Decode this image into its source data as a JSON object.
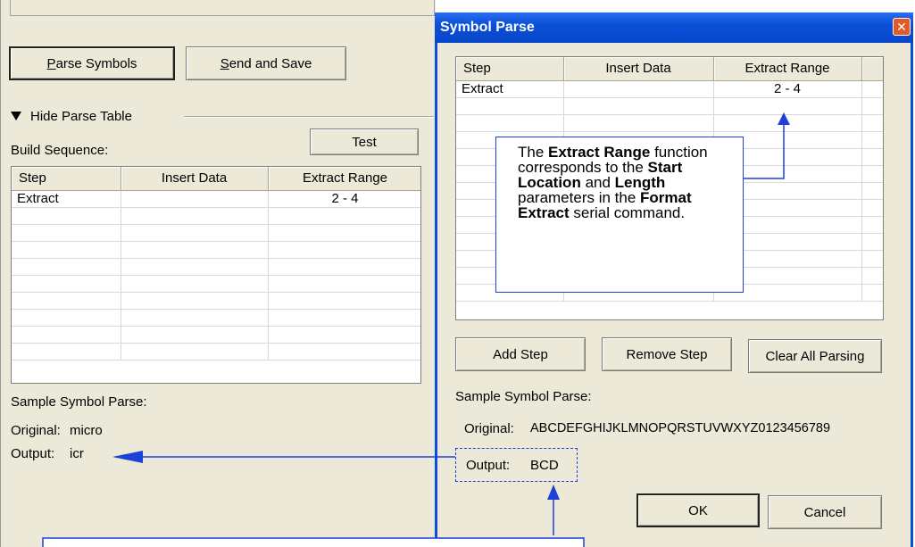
{
  "left_panel": {
    "parse_symbols_label": "Parse Symbols",
    "parse_symbols_mnemonic": "P",
    "send_and_save_label": "Send and Save",
    "send_and_save_mnemonic": "S",
    "hide_parse_table_label": "Hide Parse Table",
    "build_sequence_label": "Build Sequence:",
    "test_label": "Test",
    "table": {
      "columns": [
        "Step",
        "Insert Data",
        "Extract Range"
      ],
      "rows": [
        [
          "Extract",
          "",
          "2 - 4"
        ]
      ]
    },
    "sample_label": "Sample Symbol Parse:",
    "original_label": "Original:",
    "original_value": "micro",
    "output_label": "Output:",
    "output_value": "icr"
  },
  "dialog": {
    "title": "Symbol Parse",
    "close_glyph": "✕",
    "table": {
      "columns": [
        "Step",
        "Insert Data",
        "Extract Range"
      ],
      "rows": [
        [
          "Extract",
          "",
          "2 - 4"
        ]
      ]
    },
    "add_step_label": "Add Step",
    "remove_step_label": "Remove Step",
    "clear_all_label": "Clear All Parsing",
    "sample_label": "Sample Symbol Parse:",
    "original_label": "Original:",
    "original_value": "ABCDEFGHIJKLMNOPQRSTUVWXYZ0123456789",
    "output_label": "Output:",
    "output_value": "BCD",
    "ok_label": "OK",
    "cancel_label": "Cancel"
  },
  "callout": {
    "t1": "The ",
    "b1": "Extract Range",
    "t2": " function corresponds to the ",
    "b2": "Start Location",
    "t3": " and ",
    "b3": "Length",
    "t4": " parameters in the ",
    "b4": "Format Extract",
    "t5": " serial command."
  },
  "colors": {
    "window_bg": "#ece9d8",
    "title_bar": "#0a4fd8",
    "annotation_blue": "#1f3fd6",
    "close_button": "#e05a2b"
  },
  "icons": {
    "triangle": "triangle-down-icon",
    "close": "close-icon"
  }
}
